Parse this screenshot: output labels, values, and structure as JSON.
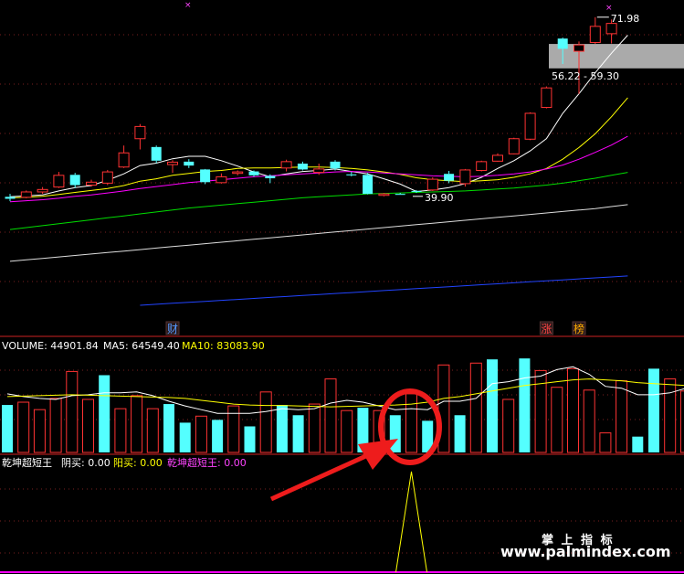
{
  "chart_data": [
    {
      "type": "candlestick",
      "candles": [
        {
          "o": 35.2,
          "h": 35.8,
          "l": 34.3,
          "c": 34.8
        },
        {
          "o": 35.1,
          "h": 36.5,
          "l": 34.9,
          "c": 36.2
        },
        {
          "o": 36.2,
          "h": 37.2,
          "l": 35.8,
          "c": 36.7
        },
        {
          "o": 37.2,
          "h": 40.3,
          "l": 37.0,
          "c": 39.6
        },
        {
          "o": 39.7,
          "h": 40.1,
          "l": 37.0,
          "c": 37.6
        },
        {
          "o": 37.6,
          "h": 38.7,
          "l": 37.3,
          "c": 38.2
        },
        {
          "o": 38.0,
          "h": 40.7,
          "l": 37.6,
          "c": 40.3
        },
        {
          "o": 41.3,
          "h": 45.7,
          "l": 41.1,
          "c": 44.2
        },
        {
          "o": 47.1,
          "h": 50.1,
          "l": 44.9,
          "c": 49.6
        },
        {
          "o": 45.4,
          "h": 45.7,
          "l": 42.1,
          "c": 42.6
        },
        {
          "o": 41.8,
          "h": 42.7,
          "l": 40.1,
          "c": 42.3
        },
        {
          "o": 42.4,
          "h": 42.9,
          "l": 41.1,
          "c": 41.6
        },
        {
          "o": 40.8,
          "h": 40.9,
          "l": 37.8,
          "c": 38.2
        },
        {
          "o": 38.1,
          "h": 40.0,
          "l": 37.9,
          "c": 39.3
        },
        {
          "o": 40.0,
          "h": 40.6,
          "l": 39.6,
          "c": 40.3
        },
        {
          "o": 40.4,
          "h": 40.6,
          "l": 39.3,
          "c": 39.6
        },
        {
          "o": 39.5,
          "h": 39.8,
          "l": 38.0,
          "c": 39.0
        },
        {
          "o": 41.1,
          "h": 42.8,
          "l": 40.4,
          "c": 42.4
        },
        {
          "o": 42.0,
          "h": 42.4,
          "l": 40.6,
          "c": 40.8
        },
        {
          "o": 40.2,
          "h": 42.0,
          "l": 39.7,
          "c": 40.9
        },
        {
          "o": 42.4,
          "h": 42.7,
          "l": 40.6,
          "c": 41.0
        },
        {
          "o": 39.8,
          "h": 40.3,
          "l": 39.4,
          "c": 39.6
        },
        {
          "o": 39.7,
          "h": 40.1,
          "l": 35.7,
          "c": 35.8
        },
        {
          "o": 35.5,
          "h": 36.0,
          "l": 35.3,
          "c": 35.8
        },
        {
          "o": 35.8,
          "h": 36.0,
          "l": 35.6,
          "c": 35.6
        },
        {
          "o": 36.4,
          "h": 36.6,
          "l": 36.0,
          "c": 36.2
        },
        {
          "o": 36.6,
          "h": 39.2,
          "l": 36.4,
          "c": 38.8
        },
        {
          "o": 39.9,
          "h": 40.5,
          "l": 38.0,
          "c": 38.5
        },
        {
          "o": 37.9,
          "h": 40.9,
          "l": 37.3,
          "c": 40.7
        },
        {
          "o": 40.6,
          "h": 42.6,
          "l": 40.4,
          "c": 42.4
        },
        {
          "o": 42.5,
          "h": 44.1,
          "l": 42.4,
          "c": 43.7
        },
        {
          "o": 44.0,
          "h": 47.3,
          "l": 43.9,
          "c": 47.1
        },
        {
          "o": 47.0,
          "h": 52.5,
          "l": 46.8,
          "c": 52.3
        },
        {
          "o": 53.5,
          "h": 57.8,
          "l": 53.3,
          "c": 57.5
        },
        {
          "o": 67.6,
          "h": 67.8,
          "l": 62.4,
          "c": 65.5
        },
        {
          "o": 65.0,
          "h": 67.0,
          "l": 56.3,
          "c": 66.3
        },
        {
          "o": 66.8,
          "h": 71.98,
          "l": 66.5,
          "c": 70.1
        },
        {
          "o": 68.6,
          "h": 71.5,
          "l": 66.6,
          "c": 70.7
        }
      ],
      "ma_lines": [
        {
          "color": "#ffffff",
          "values": [
            35.2,
            35.4,
            35.6,
            36.4,
            37.1,
            37.5,
            38.6,
            39.9,
            41.6,
            42.1,
            43.0,
            43.5,
            43.5,
            42.6,
            41.5,
            40.3,
            39.3,
            39.9,
            40.4,
            40.6,
            40.9,
            40.4,
            39.9,
            38.9,
            37.8,
            36.3,
            36.6,
            37.1,
            37.9,
            39.2,
            41.0,
            42.6,
            44.6,
            47.1,
            52.3,
            56.3,
            60.6,
            64.6,
            68.3
          ]
        },
        {
          "color": "#ffff00",
          "values": [
            35.0,
            35.1,
            35.3,
            35.7,
            36.1,
            36.5,
            36.9,
            37.5,
            38.4,
            38.9,
            39.6,
            40.0,
            40.4,
            40.6,
            41.0,
            41.1,
            41.1,
            41.2,
            41.3,
            41.3,
            41.2,
            41.0,
            40.7,
            40.3,
            39.8,
            39.1,
            38.7,
            38.5,
            38.3,
            38.5,
            38.7,
            39.2,
            39.9,
            41.0,
            42.9,
            45.3,
            48.1,
            51.6,
            55.5
          ]
        },
        {
          "color": "#ff00ff",
          "values": [
            34.2,
            34.4,
            34.6,
            34.9,
            35.3,
            35.6,
            36.0,
            36.4,
            36.9,
            37.3,
            37.7,
            38.1,
            38.4,
            38.7,
            39.0,
            39.3,
            39.5,
            39.7,
            39.9,
            40.1,
            40.3,
            40.4,
            40.3,
            40.1,
            39.9,
            39.7,
            39.5,
            39.4,
            39.3,
            39.4,
            39.6,
            39.9,
            40.3,
            40.9,
            41.7,
            42.9,
            44.3,
            45.8,
            47.6
          ]
        },
        {
          "color": "#00dd00",
          "values": [
            28.5,
            28.9,
            29.3,
            29.7,
            30.1,
            30.5,
            30.9,
            31.3,
            31.7,
            32.1,
            32.5,
            32.9,
            33.2,
            33.5,
            33.8,
            34.1,
            34.4,
            34.7,
            35.0,
            35.2,
            35.4,
            35.6,
            35.8,
            35.9,
            36.0,
            36.1,
            36.2,
            36.3,
            36.4,
            36.6,
            36.8,
            37.0,
            37.3,
            37.6,
            38.0,
            38.5,
            39.0,
            39.6,
            40.2
          ]
        },
        {
          "color": "#dddddd",
          "values": [
            22.0,
            22.3,
            22.6,
            22.9,
            23.2,
            23.5,
            23.8,
            24.1,
            24.4,
            24.7,
            25.0,
            25.3,
            25.6,
            25.9,
            26.2,
            26.5,
            26.8,
            27.1,
            27.4,
            27.7,
            28.0,
            28.3,
            28.6,
            28.9,
            29.2,
            29.5,
            29.8,
            30.1,
            30.4,
            30.7,
            31.0,
            31.3,
            31.6,
            31.9,
            32.2,
            32.5,
            32.8,
            33.2,
            33.6
          ]
        },
        {
          "color": "#2244ff",
          "start": 8,
          "values": [
            13.0,
            13.2,
            13.4,
            13.6,
            13.8,
            14.0,
            14.2,
            14.4,
            14.6,
            14.8,
            15.0,
            15.2,
            15.4,
            15.6,
            15.8,
            16.0,
            16.2,
            16.4,
            16.6,
            16.8,
            17.0,
            17.2,
            17.4,
            17.6,
            17.8,
            18.0,
            18.2,
            18.4,
            18.6,
            18.8,
            19.0
          ]
        }
      ],
      "annotations": {
        "high": "71.98",
        "low": "39.90",
        "range_box": "56.22 - 59.30"
      },
      "markers": [
        {
          "index": 10,
          "text": "财",
          "color": "#5599ff"
        },
        {
          "index": 33,
          "text": "涨",
          "color": "#ff4444"
        },
        {
          "index": 35,
          "text": "榜",
          "color": "#ffaa00"
        }
      ]
    },
    {
      "type": "bar",
      "title_values": {
        "volume": "VOLUME: 44901.84",
        "ma5": "MA5: 64549.40",
        "ma10": "MA10: 83083.90"
      },
      "values": [
        51000,
        54000,
        46000,
        58000,
        87000,
        57000,
        83000,
        47000,
        61000,
        47000,
        52000,
        32000,
        39000,
        35000,
        50000,
        28000,
        65000,
        51000,
        40000,
        52000,
        79000,
        45000,
        48000,
        45000,
        40000,
        63000,
        34000,
        94000,
        40000,
        96000,
        100000,
        57000,
        101000,
        88000,
        70000,
        90000,
        67000,
        21000,
        77000,
        17000,
        90000,
        79000,
        66000,
        38000
      ],
      "colors": [
        "c",
        "r",
        "r",
        "r",
        "r",
        "r",
        "c",
        "r",
        "r",
        "r",
        "c",
        "c",
        "r",
        "c",
        "r",
        "c",
        "r",
        "c",
        "c",
        "r",
        "r",
        "r",
        "c",
        "r",
        "c",
        "r",
        "c",
        "r",
        "c",
        "r",
        "c",
        "r",
        "c",
        "r",
        "r",
        "r",
        "r",
        "r",
        "r",
        "c",
        "c",
        "r",
        "r",
        "r"
      ],
      "ma5": [
        63000,
        60000,
        58000,
        57000,
        61000,
        62000,
        64000,
        64000,
        65000,
        61000,
        55000,
        50000,
        46000,
        42000,
        42000,
        42000,
        44000,
        47000,
        46000,
        47000,
        53000,
        56000,
        54000,
        50000,
        46000,
        47000,
        46000,
        55000,
        55000,
        58000,
        74000,
        76000,
        80000,
        82000,
        89000,
        92000,
        84000,
        71000,
        69000,
        62000,
        62000,
        64000,
        69000,
        62000
      ],
      "ma10": [
        60000,
        60500,
        61000,
        61500,
        62000,
        61500,
        61000,
        60500,
        60000,
        59500,
        59000,
        58000,
        56000,
        54000,
        52000,
        51000,
        50500,
        50500,
        50000,
        49500,
        49000,
        49500,
        50000,
        50500,
        51000,
        52000,
        54000,
        58000,
        60000,
        63000,
        66000,
        69000,
        72000,
        74000,
        76000,
        78000,
        79000,
        78000,
        77000,
        75000,
        74000,
        73000,
        72000,
        71000
      ],
      "ymax": 110000
    },
    {
      "type": "line",
      "title_values": {
        "name": "乾坤超短王",
        "yin": "阴买: 0.00",
        "yang": "阳买: 0.00",
        "name2": "乾坤超短王: 0.00"
      },
      "spike_index": 25
    }
  ],
  "watermark": {
    "cn": "掌 上 指 标",
    "url": "www.palmindex.com"
  }
}
